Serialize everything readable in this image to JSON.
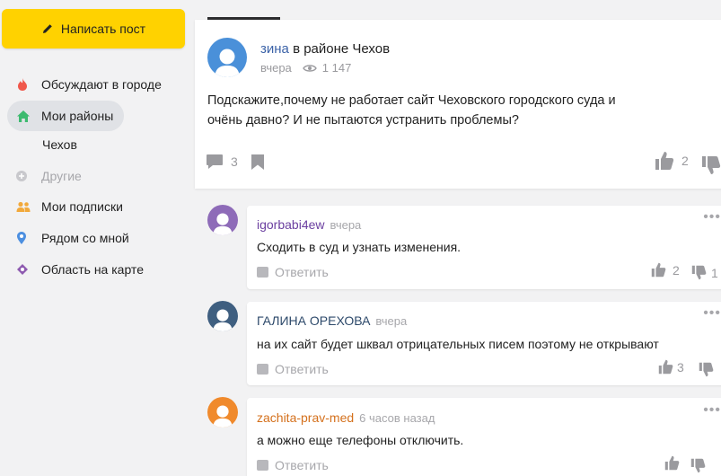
{
  "sidebar": {
    "write_label": "Написать пост",
    "items": [
      {
        "label": "Обсуждают в городе",
        "icon": "flame-icon"
      },
      {
        "label": "Мои районы",
        "icon": "home-icon"
      },
      {
        "label": "Чехов"
      },
      {
        "label": "Другие",
        "icon": "plus-icon"
      },
      {
        "label": "Мои подписки",
        "icon": "people-icon"
      },
      {
        "label": "Рядом со мной",
        "icon": "location-pin-icon"
      },
      {
        "label": "Область на карте",
        "icon": "map-icon"
      }
    ]
  },
  "post": {
    "author": "зина",
    "location": "в районе Чехов",
    "time": "вчера",
    "views": "1 147",
    "text": "Подскажите,почему не работает сайт Чеховского городского суда и очёнь давно? И не пытаются устранить проблемы?",
    "comments_count": "3",
    "likes": "2",
    "avatar_color": "#4a90d9"
  },
  "comments": [
    {
      "author": "igorbabi4ew",
      "time": "вчера",
      "text": "Сходить в суд и узнать изменения.",
      "reply_label": "Ответить",
      "likes": "2",
      "dislikes": "1",
      "name_color": "#6b3fa0",
      "avatar_color": "#8e6bb8"
    },
    {
      "author": "ГАЛИНА ОРЕХОВА",
      "time": "вчера",
      "text": "на их сайт будет шквал отрицательных писем поэтому не открывают",
      "reply_label": "Ответить",
      "likes": "3",
      "dislikes": "",
      "name_color": "#2e4a6b",
      "avatar_color": "#3f5f80"
    },
    {
      "author": "zachita-prav-med",
      "time": "6 часов назад",
      "text": "а можно еще телефоны отключить.",
      "reply_label": "Ответить",
      "likes": "",
      "dislikes": "",
      "name_color": "#d4701c",
      "avatar_color": "#f08a2c"
    }
  ]
}
